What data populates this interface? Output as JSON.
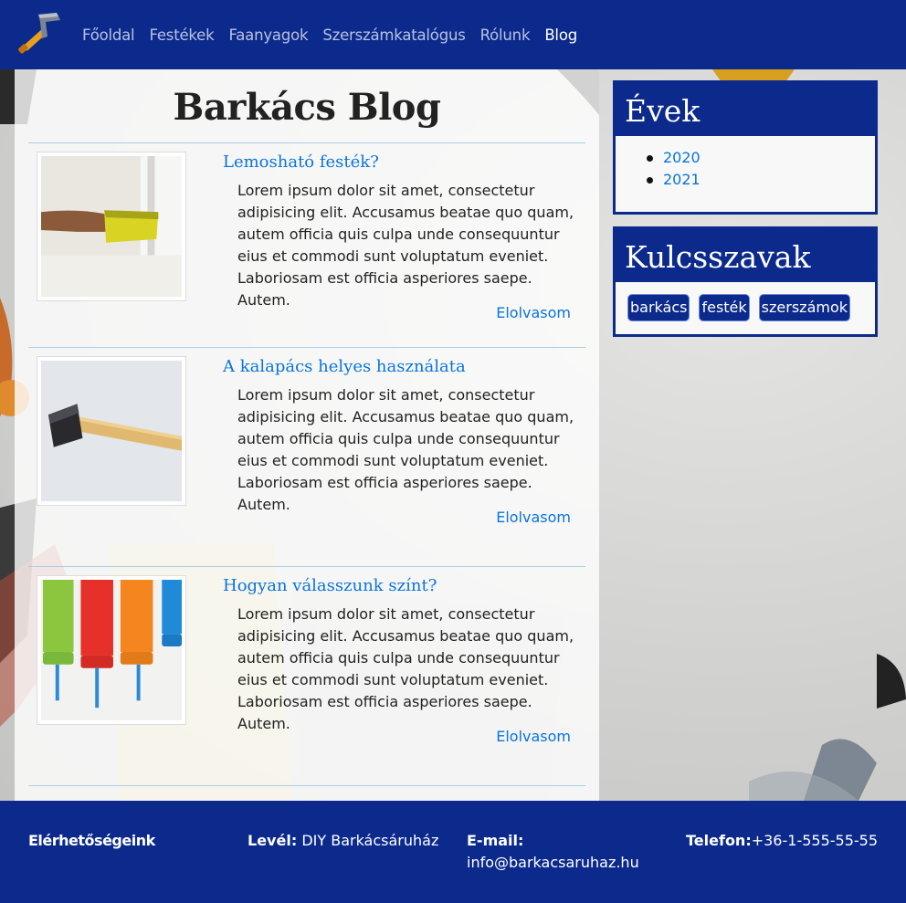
{
  "nav": {
    "items": [
      "Főoldal",
      "Festékek",
      "Faanyagok",
      "Szerszámkatalógus",
      "Rólunk",
      "Blog"
    ],
    "active": "Blog"
  },
  "main": {
    "title": "Barkács Blog",
    "posts": [
      {
        "title": "Lemosható festék?",
        "excerpt": "Lorem ipsum dolor sit amet, consectetur adipisicing elit. Accusamus beatae quo quam, autem officia quis culpa unde consequuntur eius et commodi sunt voluptatum eveniet. Laboriosam est officia asperiores saepe. Autem.",
        "link": "Elolvasom",
        "image": "sponge-cleaning-photo"
      },
      {
        "title": "A kalapács helyes használata",
        "excerpt": "Lorem ipsum dolor sit amet, consectetur adipisicing elit. Accusamus beatae quo quam, autem officia quis culpa unde consequuntur eius et commodi sunt voluptatum eveniet. Laboriosam est officia asperiores saepe. Autem.",
        "link": "Elolvasom",
        "image": "hammer-photo"
      },
      {
        "title": "Hogyan válasszunk színt?",
        "excerpt": "Lorem ipsum dolor sit amet, consectetur adipisicing elit. Accusamus beatae quo quam, autem officia quis culpa unde consequuntur eius et commodi sunt voluptatum eveniet. Laboriosam est officia asperiores saepe. Autem.",
        "link": "Elolvasom",
        "image": "paint-rollers-photo"
      }
    ]
  },
  "sidebar": {
    "years": {
      "title": "Évek",
      "items": [
        "2020",
        "2021"
      ]
    },
    "keywords": {
      "title": "Kulcsszavak",
      "items": [
        "barkács",
        "festék",
        "szerszámok"
      ]
    }
  },
  "footer": {
    "heading": "Elérhetőségeink",
    "mail_label": "Levél:",
    "mail_value": "DIY Barkácsáruház",
    "email_label": "E-mail:",
    "email_value": "info@barkacsaruhaz.hu",
    "phone_label": "Telefon:",
    "phone_value": "+36-1-555-55-55"
  },
  "colors": {
    "brand": "#0c2a8c",
    "link": "#0a74e0",
    "rule": "#a9cfe6"
  }
}
